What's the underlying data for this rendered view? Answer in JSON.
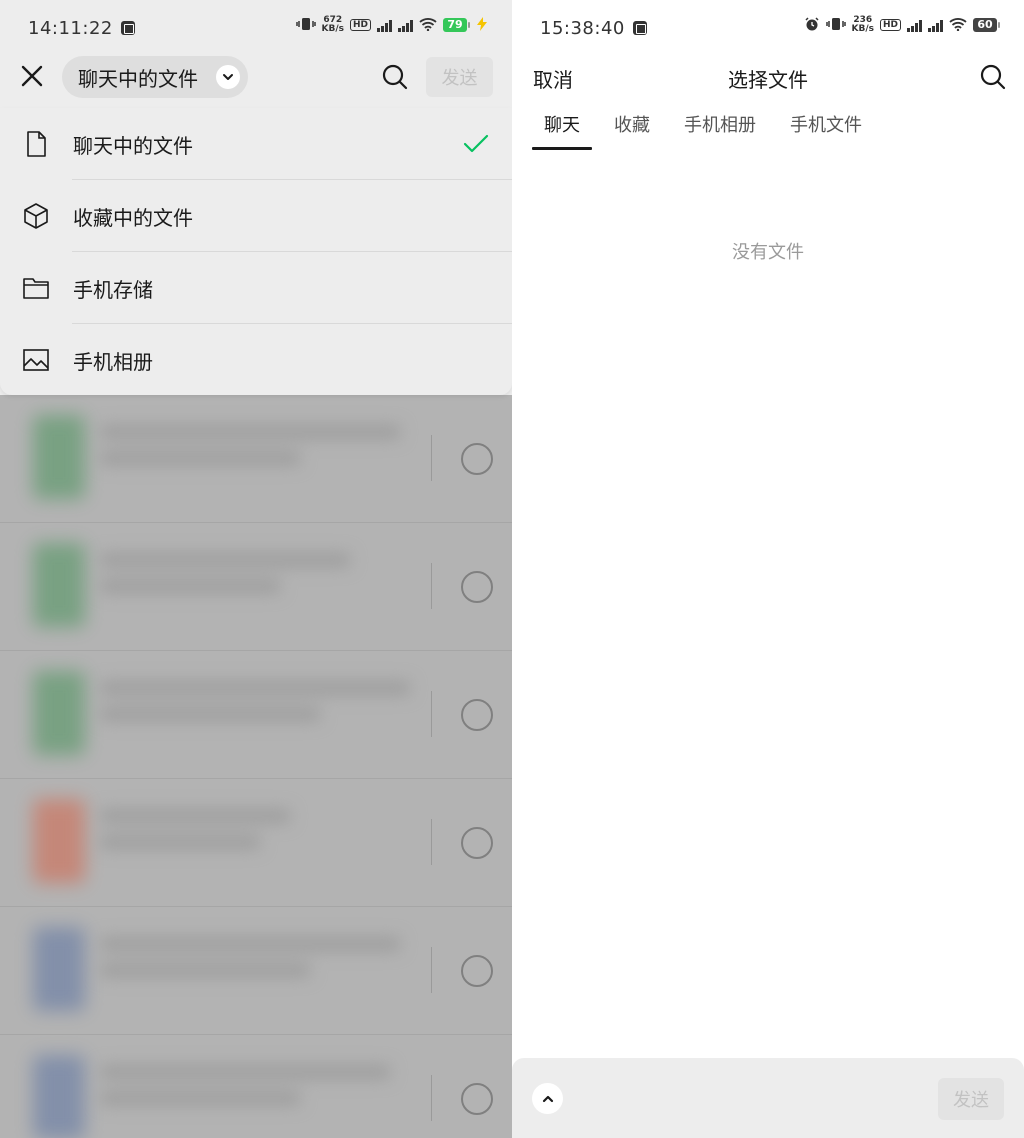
{
  "left": {
    "status": {
      "time": "14:11:22",
      "speed": "672",
      "speed_unit": "KB/s",
      "battery": "79",
      "battery_color": "#34c759"
    },
    "dropdown": {
      "label": "聊天中的文件"
    },
    "send_label": "发送",
    "menu": [
      {
        "label": "聊天中的文件",
        "icon": "file-icon",
        "selected": true
      },
      {
        "label": "收藏中的文件",
        "icon": "cube-icon",
        "selected": false
      },
      {
        "label": "手机存储",
        "icon": "folder-icon",
        "selected": false
      },
      {
        "label": "手机相册",
        "icon": "image-icon",
        "selected": false
      }
    ],
    "check_color": "#07c160",
    "blurred_rows": [
      {
        "thumb_color": "#6f9e7a"
      },
      {
        "thumb_color": "#6f9e7a"
      },
      {
        "thumb_color": "#6f9e7a"
      },
      {
        "thumb_color": "#c8806f"
      },
      {
        "thumb_color": "#7b8aa8"
      },
      {
        "thumb_color": "#7b8aa8"
      }
    ]
  },
  "right": {
    "status": {
      "time": "15:38:40",
      "speed": "236",
      "speed_unit": "KB/s",
      "battery": "60",
      "battery_color": "#444444"
    },
    "cancel_label": "取消",
    "title": "选择文件",
    "tabs": [
      {
        "label": "聊天",
        "active": true
      },
      {
        "label": "收藏",
        "active": false
      },
      {
        "label": "手机相册",
        "active": false
      },
      {
        "label": "手机文件",
        "active": false
      }
    ],
    "empty_text": "没有文件",
    "send_label": "发送"
  }
}
